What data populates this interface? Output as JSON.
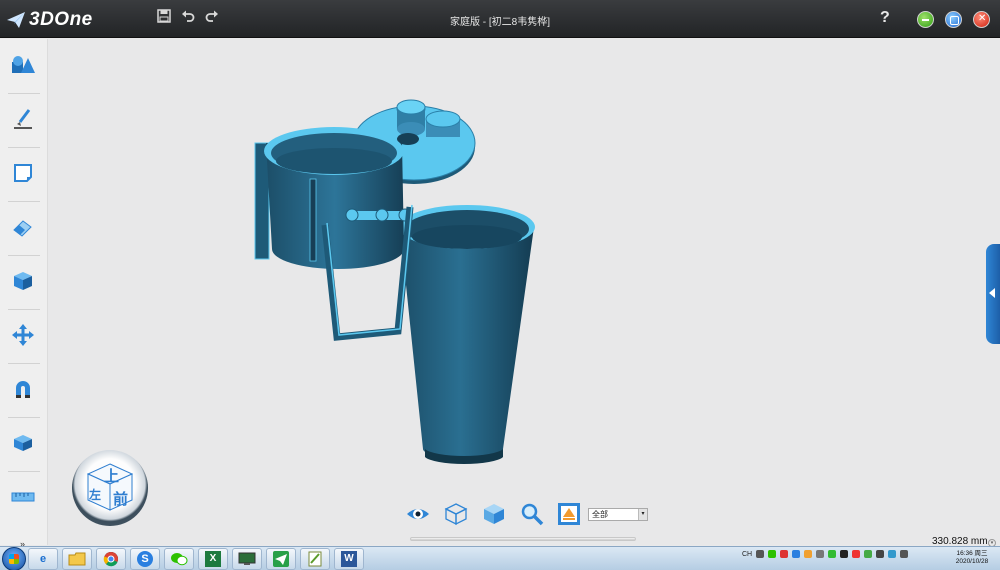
{
  "app": {
    "logo_text": "3DOne",
    "window_title": "家庭版 - [初二8韦隽桦]"
  },
  "titlebar": {
    "quick_actions": [
      {
        "icon": "save-icon"
      },
      {
        "icon": "undo-icon"
      },
      {
        "icon": "redo-icon"
      }
    ],
    "help_label": "?",
    "window_buttons": [
      {
        "icon": "minimize-icon",
        "color": "#2f9e14"
      },
      {
        "icon": "maximize-icon",
        "color": "#1560d0"
      },
      {
        "icon": "close-icon",
        "color": "#d0200e"
      }
    ]
  },
  "left_toolbar": {
    "tools": [
      {
        "icon": "basic-solid-icon"
      },
      {
        "icon": "sketch-pen-icon"
      },
      {
        "icon": "sketch-edit-icon"
      },
      {
        "icon": "feature-eraser-icon"
      },
      {
        "icon": "special-feature-cube-icon"
      },
      {
        "icon": "move-arrows-icon"
      },
      {
        "icon": "magnet-combine-icon"
      },
      {
        "icon": "array-box-icon"
      },
      {
        "icon": "measure-ruler-icon"
      }
    ],
    "more_label": "»"
  },
  "viewcube": {
    "top_label": "上",
    "front_label": "前",
    "left_label": "左"
  },
  "view_toolbar": {
    "tools": [
      {
        "icon": "eye-icon"
      },
      {
        "icon": "wireframe-cube-icon"
      },
      {
        "icon": "solid-cube-icon"
      },
      {
        "icon": "zoom-fit-icon"
      },
      {
        "icon": "render-mode-icon"
      }
    ],
    "filter_value": "全部"
  },
  "status": {
    "measurement": "330.828 mm"
  },
  "taskbar": {
    "apps": [
      {
        "icon": "ie-icon",
        "label": "e"
      },
      {
        "icon": "folder-icon",
        "label": ""
      },
      {
        "icon": "chrome-icon",
        "label": ""
      },
      {
        "icon": "sogou-icon",
        "label": "S"
      },
      {
        "icon": "wechat-icon",
        "label": ""
      },
      {
        "icon": "excel-icon",
        "label": "X"
      },
      {
        "icon": "monitor-app-icon",
        "label": ""
      },
      {
        "icon": "3done-app-icon",
        "label": ""
      },
      {
        "icon": "notepad-icon",
        "label": ""
      },
      {
        "icon": "word-icon",
        "label": "W"
      }
    ],
    "tray_text": "CH",
    "clock_time": "16:36 周三",
    "clock_date": "2020/10/28"
  },
  "colors": {
    "model_dark": "#1e5a78",
    "model_light": "#5bc8ef",
    "accent": "#2f86d6"
  }
}
